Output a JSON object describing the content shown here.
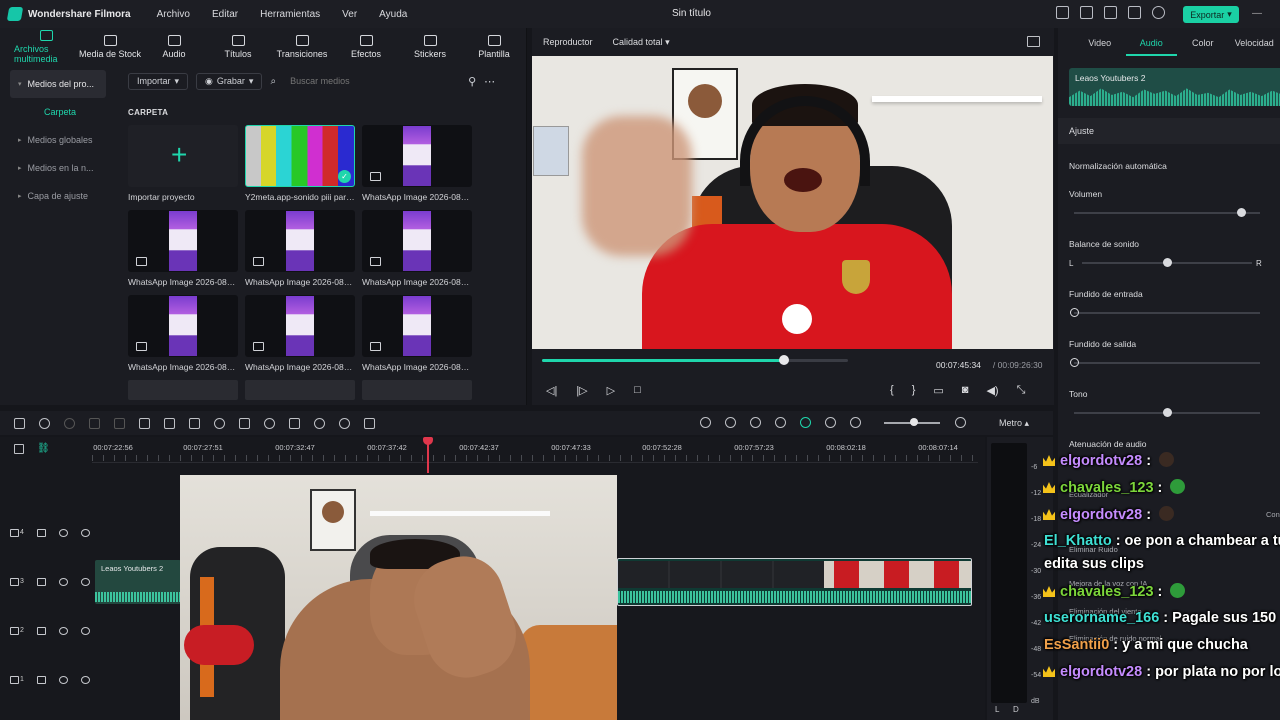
{
  "app": {
    "name": "Wondershare Filmora",
    "menu": [
      "Archivo",
      "Editar",
      "Herramientas",
      "Ver",
      "Ayuda"
    ],
    "doc_title": "Sin título",
    "export_label": "Exportar"
  },
  "media": {
    "tabs": [
      {
        "label": "Archivos multimedia",
        "icon": "folder-icon",
        "active": true
      },
      {
        "label": "Media de Stock",
        "icon": "stock-icon"
      },
      {
        "label": "Audio",
        "icon": "music-icon"
      },
      {
        "label": "Títulos",
        "icon": "title-icon"
      },
      {
        "label": "Transiciones",
        "icon": "transition-icon"
      },
      {
        "label": "Efectos",
        "icon": "effects-icon"
      },
      {
        "label": "Stickers",
        "icon": "sticker-icon"
      },
      {
        "label": "Plantilla",
        "icon": "template-icon"
      }
    ],
    "sidebar": [
      {
        "label": "Medios del pro..."
      },
      {
        "label": "Carpeta"
      },
      {
        "label": "Medios globales"
      },
      {
        "label": "Medios en la n..."
      },
      {
        "label": "Capa de ajuste"
      }
    ],
    "import_label": "Importar",
    "record_label": "Grabar",
    "search_placeholder": "Buscar medios",
    "folder_title": "CARPETA",
    "items": [
      {
        "caption": "Importar proyecto",
        "kind": "import"
      },
      {
        "caption": "Y2meta.app-sonido piii para...",
        "kind": "bars"
      },
      {
        "caption": "WhatsApp Image 2026-08-0...",
        "kind": "phone"
      },
      {
        "caption": "WhatsApp Image 2026-08-0...",
        "kind": "phone"
      },
      {
        "caption": "WhatsApp Image 2026-08-0...",
        "kind": "phone"
      },
      {
        "caption": "WhatsApp Image 2026-08-0...",
        "kind": "phone"
      },
      {
        "caption": "WhatsApp Image 2026-08-0...",
        "kind": "phone"
      },
      {
        "caption": "WhatsApp Image 2026-08-0...",
        "kind": "phone"
      },
      {
        "caption": "WhatsApp Image 2026-08-0...",
        "kind": "phone"
      }
    ]
  },
  "player": {
    "tab": "Reproductor",
    "quality": "Calidad total",
    "current_time": "00:07:45:34",
    "total_time": "/ 00:09:26:30",
    "progress": 0.79
  },
  "inspector": {
    "tabs": [
      "Video",
      "Audio",
      "Color",
      "Velocidad"
    ],
    "active_tab": "Audio",
    "clip_name": "Leaos Youtubers 2",
    "section": "Ajuste",
    "auto_norm": "Normalización automática",
    "volume": "Volumen",
    "balance": "Balance de sonido",
    "fade_in": "Fundido de entrada",
    "fade_out": "Fundido  de salida",
    "pitch": "Tono",
    "ducking": "Atenuación de audio",
    "l": "L",
    "r": "R",
    "volume_level": 0.9,
    "balance_level": 0.5,
    "fade_in_level": 0.0,
    "fade_out_level": 0.0,
    "pitch_level": 0.5
  },
  "timeline": {
    "metro_label": "Metro",
    "ruler": [
      "00:07:22:56",
      "00:07:27:51",
      "00:07:32:47",
      "00:07:37:42",
      "00:07:42:37",
      "00:07:47:33",
      "00:07:52:28",
      "00:07:57:23",
      "00:08:02:18",
      "00:08:07:14"
    ],
    "clip_name": "Leaos Youtubers 2",
    "tracks": [
      "4",
      "3",
      "2",
      "1"
    ]
  },
  "meter": {
    "labels": [
      "-6",
      "-12",
      "-18",
      "-24",
      "-30",
      "-36",
      "-42",
      "-48",
      "-54",
      "dB"
    ],
    "left": "L",
    "right": "D"
  },
  "chat": [
    {
      "user": "elgordotv28",
      "text": " : ",
      "color": "purple",
      "crown": true,
      "emoji": "dark"
    },
    {
      "user": "chavales_123",
      "text": " : ",
      "color": "green",
      "crown": true,
      "emoji": "green"
    },
    {
      "user": "elgordotv28",
      "text": " : ",
      "color": "purple",
      "crown": true,
      "emoji": "dark"
    },
    {
      "user": "El_Khatto",
      "text": " : oe pon a chambear a tus",
      "color": "teal",
      "crown": false
    },
    {
      "user": "",
      "text": "edita sus clips",
      "color": "white",
      "crown": false
    },
    {
      "user": "chavales_123",
      "text": " : ",
      "color": "green",
      "crown": true,
      "emoji": "green"
    },
    {
      "user": "userorname_166",
      "text": " : Pagale sus 150",
      "color": "teal",
      "crown": false
    },
    {
      "user": "EsSantii0",
      "text": " : y a mi que chucha",
      "color": "orange",
      "crown": false
    },
    {
      "user": "elgordotv28",
      "text": " : por plata no por los",
      "color": "purple",
      "crown": true
    }
  ],
  "faint_labels": [
    "Ecualizador",
    "Eliminar Ruido",
    "Mejora de la voz con IA",
    "Eliminación del viento",
    "Eliminación de ruido normal",
    "Con"
  ]
}
